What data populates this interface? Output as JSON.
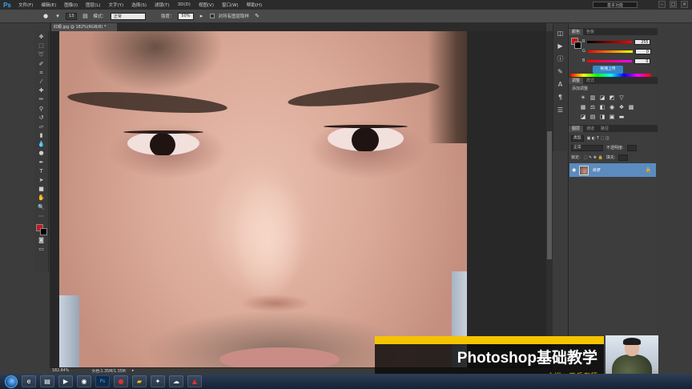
{
  "app": {
    "logo": "Ps",
    "workspace": "基本功能"
  },
  "window_controls": [
    "–",
    "□",
    "×"
  ],
  "menu": [
    "文件(F)",
    "编辑(E)",
    "图像(I)",
    "图层(L)",
    "文字(Y)",
    "选择(S)",
    "滤镜(T)",
    "3D(D)",
    "视图(V)",
    "窗口(W)",
    "帮助(H)"
  ],
  "options_bar": {
    "brush_size": "13",
    "mode_label": "模式：",
    "mode_value": "正常",
    "strength_label": "强度：",
    "strength_value": "50%",
    "sample_all_label": "对所有图层取样"
  },
  "document": {
    "tab_title": "红眼.jpg @ 182%(RGB/8) *"
  },
  "status_bar": {
    "zoom": "182.84%",
    "doc_size": "文档:1.35M/1.35M"
  },
  "color_panel": {
    "tabs": [
      "颜色",
      "色板"
    ],
    "sliders": [
      {
        "label": "R",
        "value": "255"
      },
      {
        "label": "G",
        "value": "0"
      },
      {
        "label": "B",
        "value": "0"
      }
    ],
    "tooltip": "拖拽上传"
  },
  "adjustments_panel": {
    "tabs": [
      "调整",
      "样式"
    ],
    "title": "添加调整"
  },
  "layers_panel": {
    "tabs": [
      "图层",
      "通道",
      "路径"
    ],
    "filter_label": "类型",
    "blend_mode": "正常",
    "opacity_label": "不透明度:",
    "lock_label": "锁定:",
    "fill_label": "填充:",
    "layer_name": "背景"
  },
  "branding": {
    "course_title": "Photoshop基础教学",
    "instructor": "主讲：王兵老师"
  },
  "colors": {
    "foreground": "#c8181b",
    "background": "#000000",
    "accent_yellow": "#f5c400",
    "selected_layer": "#5b8bbf"
  }
}
